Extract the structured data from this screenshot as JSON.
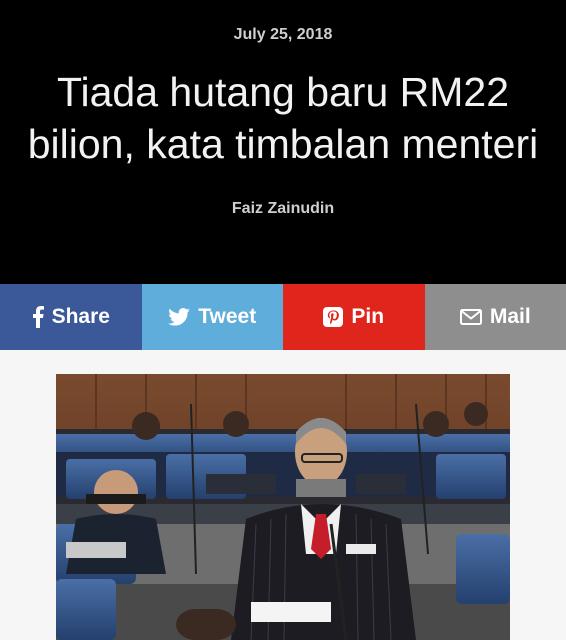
{
  "article": {
    "date": "July 25, 2018",
    "title": "Tiada hutang baru RM22 bilion, kata timbalan menteri",
    "author": "Faiz Zainudin"
  },
  "share": {
    "share_label": "Share",
    "tweet_label": "Tweet",
    "pin_label": "Pin",
    "mail_label": "Mail"
  },
  "colors": {
    "facebook": "#3b5998",
    "twitter": "#5faddb",
    "pinterest": "#e0261c",
    "mail": "#8e8e8e"
  },
  "icons": [
    "facebook-icon",
    "twitter-icon",
    "pinterest-icon",
    "mail-icon"
  ]
}
